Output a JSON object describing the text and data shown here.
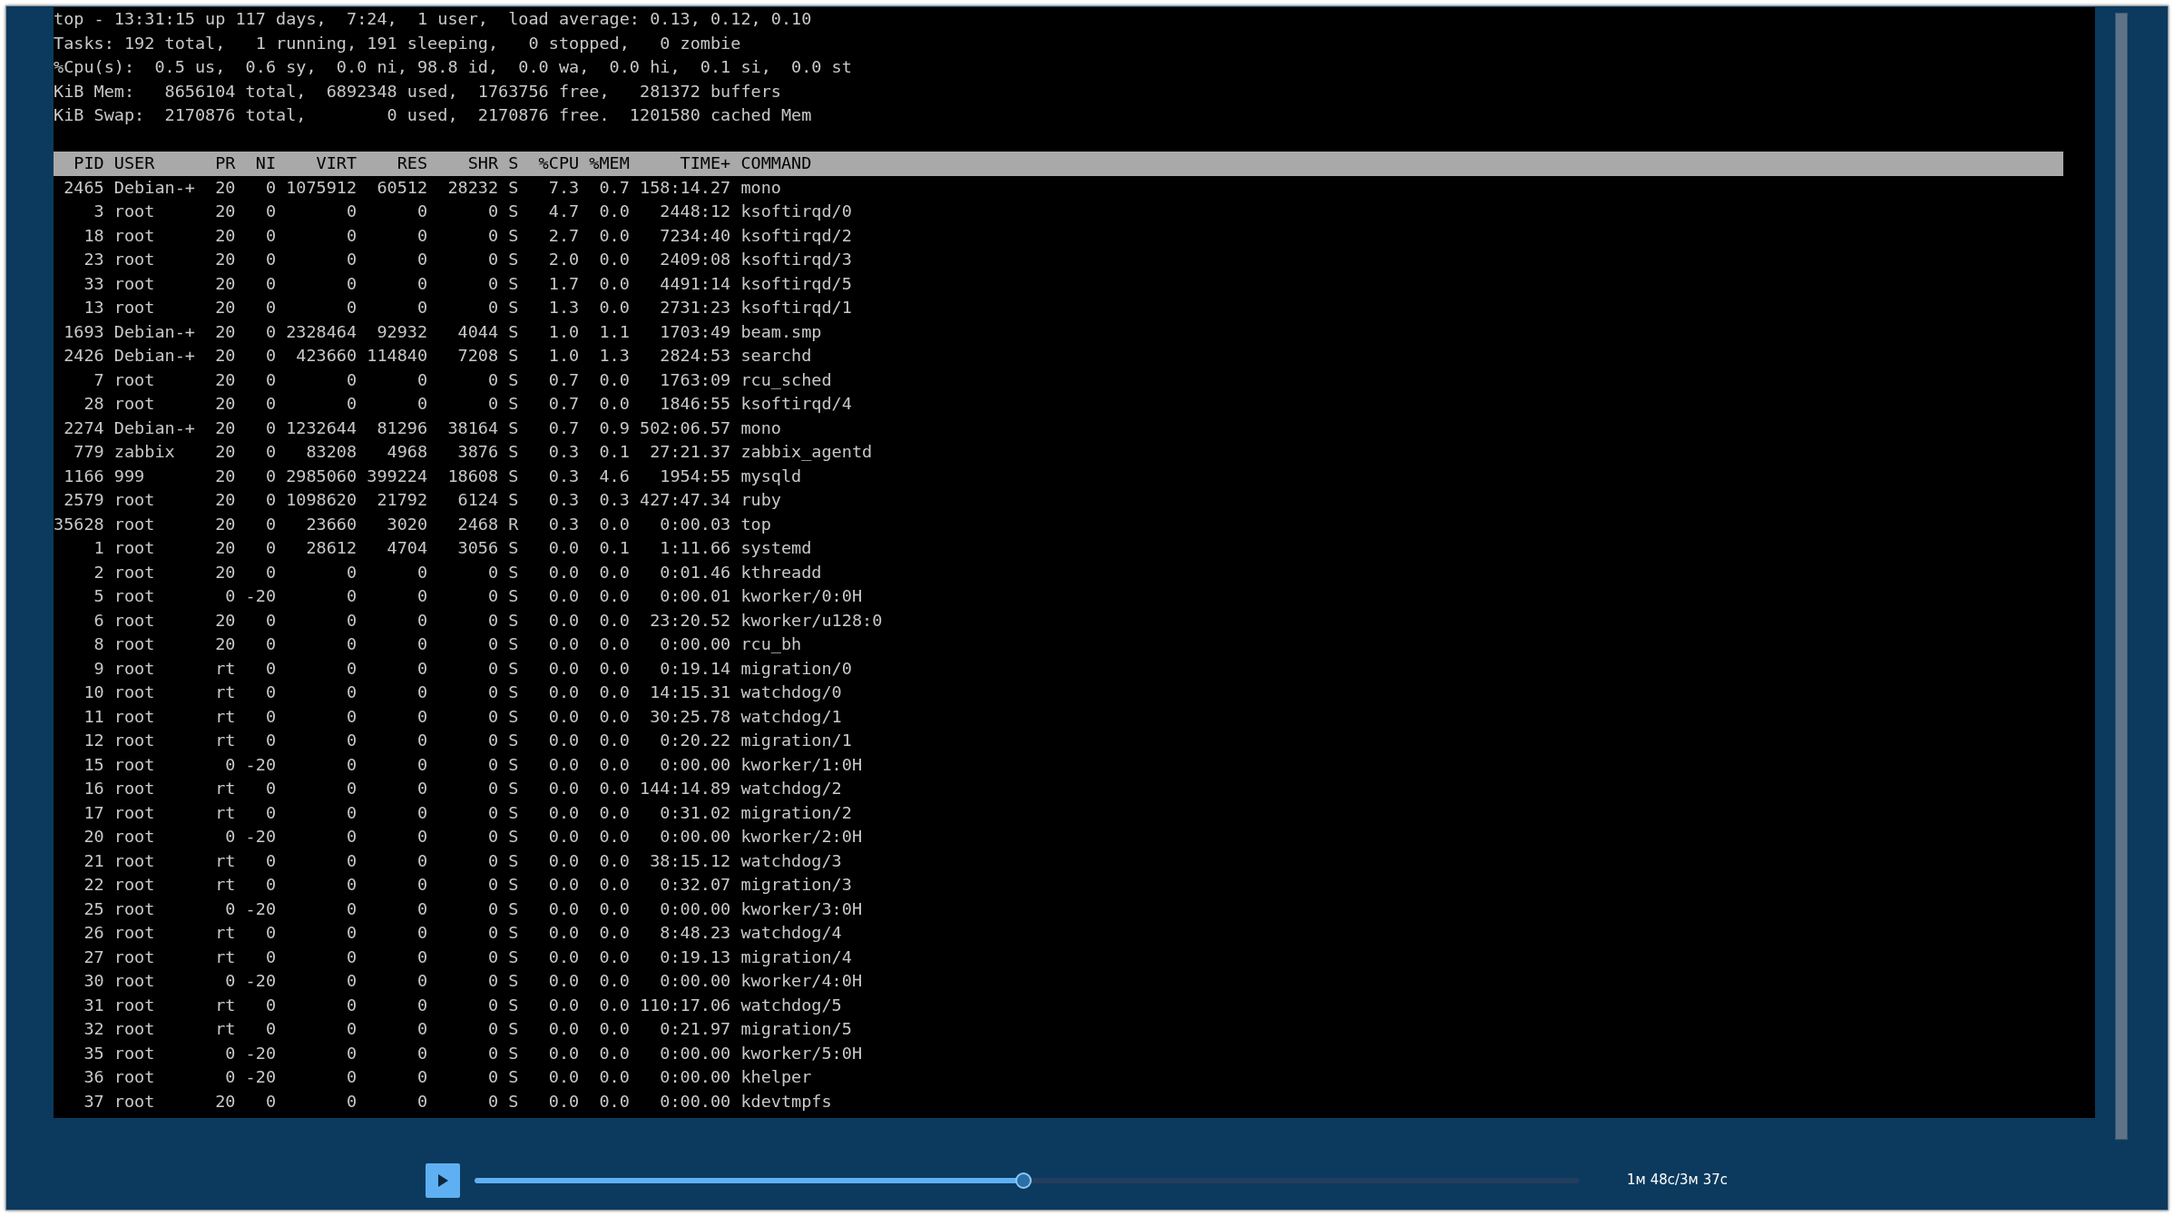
{
  "terminal": {
    "summary_lines": [
      "top - 13:31:15 up 117 days,  7:24,  1 user,  load average: 0.13, 0.12, 0.10",
      "Tasks: 192 total,   1 running, 191 sleeping,   0 stopped,   0 zombie",
      "%Cpu(s):  0.5 us,  0.6 sy,  0.0 ni, 98.8 id,  0.0 wa,  0.0 hi,  0.1 si,  0.0 st",
      "KiB Mem:   8656104 total,  6892348 used,  1763756 free,   281372 buffers",
      "KiB Swap:  2170876 total,        0 used,  2170876 free.  1201580 cached Mem"
    ],
    "header_line": "  PID USER      PR  NI    VIRT    RES    SHR S  %CPU %MEM     TIME+ COMMAND",
    "process_lines": [
      " 2465 Debian-+  20   0 1075912  60512  28232 S   7.3  0.7 158:14.27 mono",
      "    3 root      20   0       0      0      0 S   4.7  0.0   2448:12 ksoftirqd/0",
      "   18 root      20   0       0      0      0 S   2.7  0.0   7234:40 ksoftirqd/2",
      "   23 root      20   0       0      0      0 S   2.0  0.0   2409:08 ksoftirqd/3",
      "   33 root      20   0       0      0      0 S   1.7  0.0   4491:14 ksoftirqd/5",
      "   13 root      20   0       0      0      0 S   1.3  0.0   2731:23 ksoftirqd/1",
      " 1693 Debian-+  20   0 2328464  92932   4044 S   1.0  1.1   1703:49 beam.smp",
      " 2426 Debian-+  20   0  423660 114840   7208 S   1.0  1.3   2824:53 searchd",
      "    7 root      20   0       0      0      0 S   0.7  0.0   1763:09 rcu_sched",
      "   28 root      20   0       0      0      0 S   0.7  0.0   1846:55 ksoftirqd/4",
      " 2274 Debian-+  20   0 1232644  81296  38164 S   0.7  0.9 502:06.57 mono",
      "  779 zabbix    20   0   83208   4968   3876 S   0.3  0.1  27:21.37 zabbix_agentd",
      " 1166 999       20   0 2985060 399224  18608 S   0.3  4.6   1954:55 mysqld",
      " 2579 root      20   0 1098620  21792   6124 S   0.3  0.3 427:47.34 ruby",
      "35628 root      20   0   23660   3020   2468 R   0.3  0.0   0:00.03 top",
      "    1 root      20   0   28612   4704   3056 S   0.0  0.1   1:11.66 systemd",
      "    2 root      20   0       0      0      0 S   0.0  0.0   0:01.46 kthreadd",
      "    5 root       0 -20       0      0      0 S   0.0  0.0   0:00.01 kworker/0:0H",
      "    6 root      20   0       0      0      0 S   0.0  0.0  23:20.52 kworker/u128:0",
      "    8 root      20   0       0      0      0 S   0.0  0.0   0:00.00 rcu_bh",
      "    9 root      rt   0       0      0      0 S   0.0  0.0   0:19.14 migration/0",
      "   10 root      rt   0       0      0      0 S   0.0  0.0  14:15.31 watchdog/0",
      "   11 root      rt   0       0      0      0 S   0.0  0.0  30:25.78 watchdog/1",
      "   12 root      rt   0       0      0      0 S   0.0  0.0   0:20.22 migration/1",
      "   15 root       0 -20       0      0      0 S   0.0  0.0   0:00.00 kworker/1:0H",
      "   16 root      rt   0       0      0      0 S   0.0  0.0 144:14.89 watchdog/2",
      "   17 root      rt   0       0      0      0 S   0.0  0.0   0:31.02 migration/2",
      "   20 root       0 -20       0      0      0 S   0.0  0.0   0:00.00 kworker/2:0H",
      "   21 root      rt   0       0      0      0 S   0.0  0.0  38:15.12 watchdog/3",
      "   22 root      rt   0       0      0      0 S   0.0  0.0   0:32.07 migration/3",
      "   25 root       0 -20       0      0      0 S   0.0  0.0   0:00.00 kworker/3:0H",
      "   26 root      rt   0       0      0      0 S   0.0  0.0   8:48.23 watchdog/4",
      "   27 root      rt   0       0      0      0 S   0.0  0.0   0:19.13 migration/4",
      "   30 root       0 -20       0      0      0 S   0.0  0.0   0:00.00 kworker/4:0H",
      "   31 root      rt   0       0      0      0 S   0.0  0.0 110:17.06 watchdog/5",
      "   32 root      rt   0       0      0      0 S   0.0  0.0   0:21.97 migration/5",
      "   35 root       0 -20       0      0      0 S   0.0  0.0   0:00.00 kworker/5:0H",
      "   36 root       0 -20       0      0      0 S   0.0  0.0   0:00.00 khelper",
      "   37 root      20   0       0      0      0 S   0.0  0.0   0:00.00 kdevtmpfs"
    ]
  },
  "player": {
    "playing": false,
    "level": 0.497,
    "time": "1м 48с/3м 37с"
  }
}
